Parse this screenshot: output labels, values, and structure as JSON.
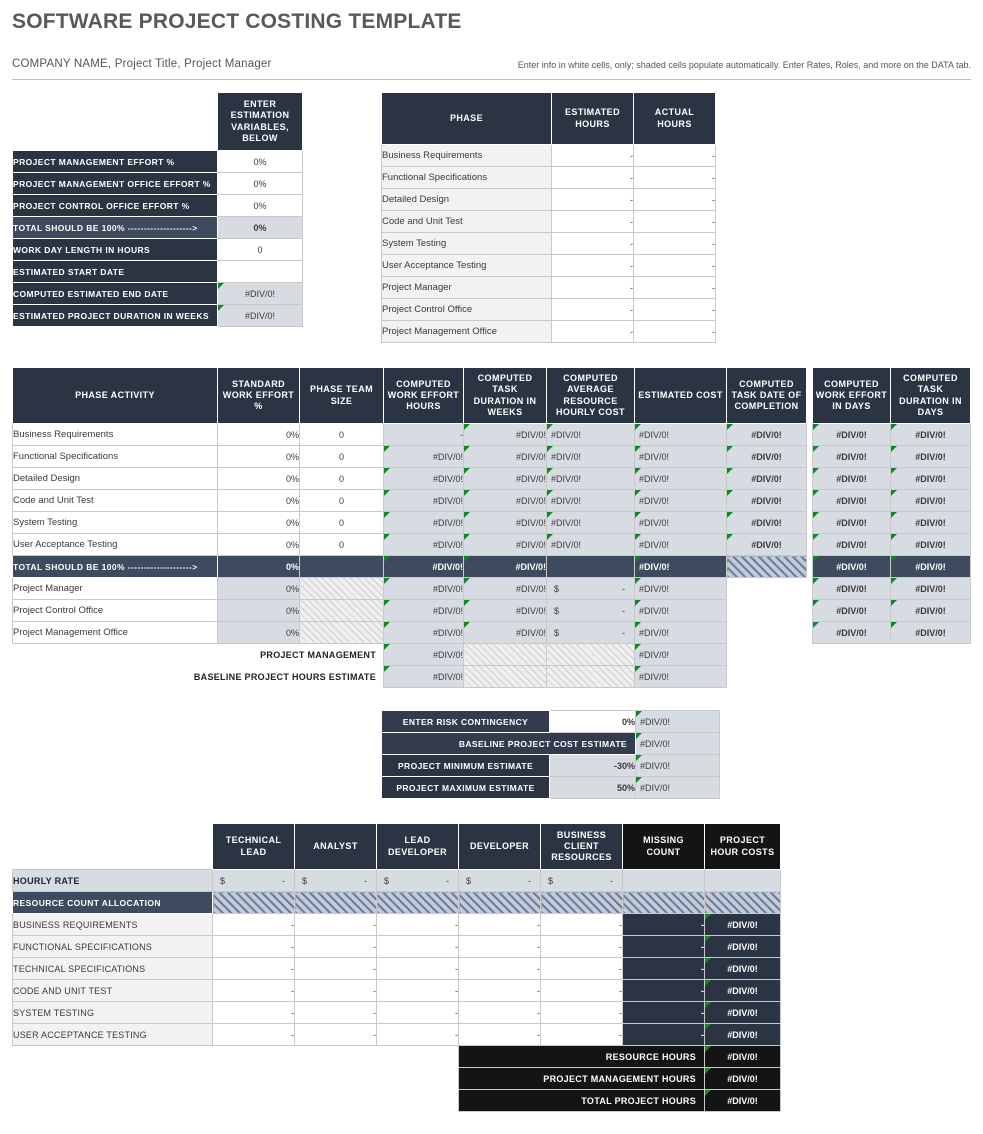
{
  "header": {
    "title": "SOFTWARE PROJECT COSTING TEMPLATE",
    "subtitle_left": "COMPANY NAME, Project Title, Project Manager",
    "subtitle_right": "Enter info in white cells, only; shaded cells populate automatically.  Enter Rates, Roles, and more on the DATA tab."
  },
  "colors": {
    "header_navy": "#2b3443",
    "header_black": "#141414",
    "row_shade": "#d7dce3",
    "total_row": "#3e4a5e",
    "title_grey": "#59595b"
  },
  "estimation": {
    "col_header": "ENTER ESTIMATION VARIABLES, BELOW",
    "rows": [
      {
        "label": "PROJECT MANAGEMENT EFFORT %",
        "value": "0%",
        "kind": "input"
      },
      {
        "label": "PROJECT MANAGEMENT OFFICE EFFORT %",
        "value": "0%",
        "kind": "input"
      },
      {
        "label": "PROJECT CONTROL OFFICE EFFORT %",
        "value": "0%",
        "kind": "input"
      },
      {
        "label": "TOTAL SHOULD BE 100% -------------------->",
        "value": "0%",
        "kind": "total"
      },
      {
        "label": "WORK DAY LENGTH IN HOURS",
        "value": "0",
        "kind": "input"
      },
      {
        "label": "ESTIMATED START DATE",
        "value": "",
        "kind": "input"
      },
      {
        "label": "COMPUTED ESTIMATED END DATE",
        "value": "#DIV/0!",
        "kind": "computed"
      },
      {
        "label": "ESTIMATED PROJECT DURATION IN WEEKS",
        "value": "#DIV/0!",
        "kind": "computed"
      }
    ]
  },
  "phase_table": {
    "columns": [
      "PHASE",
      "ESTIMATED HOURS",
      "ACTUAL HOURS"
    ],
    "rows": [
      {
        "phase": "Business Requirements",
        "estimated": "-",
        "actual": "-"
      },
      {
        "phase": "Functional Specifications",
        "estimated": "-",
        "actual": "-"
      },
      {
        "phase": "Detailed Design",
        "estimated": "-",
        "actual": "-"
      },
      {
        "phase": "Code and Unit Test",
        "estimated": "-",
        "actual": "-"
      },
      {
        "phase": "System Testing",
        "estimated": "-",
        "actual": "-"
      },
      {
        "phase": "User Acceptance Testing",
        "estimated": "-",
        "actual": "-"
      },
      {
        "phase": "Project Manager",
        "estimated": "-",
        "actual": "-"
      },
      {
        "phase": "Project Control Office",
        "estimated": "-",
        "actual": "-"
      },
      {
        "phase": "Project Management Office",
        "estimated": "-",
        "actual": "-"
      }
    ]
  },
  "activity_table": {
    "columns": [
      "PHASE ACTIVITY",
      "STANDARD WORK EFFORT %",
      "PHASE TEAM SIZE",
      "COMPUTED WORK EFFORT HOURS",
      "COMPUTED TASK DURATION IN WEEKS",
      "COMPUTED AVERAGE RESOURCE HOURLY COST",
      "ESTIMATED COST",
      "COMPUTED TASK DATE OF COMPLETION"
    ],
    "rows": [
      {
        "activity": "Business Requirements",
        "effort": "0%",
        "team": "0",
        "hours": "-",
        "weeks": "#DIV/0!",
        "rate": "#DIV/0!",
        "cost": "#DIV/0!",
        "completion": "#DIV/0!"
      },
      {
        "activity": "Functional Specifications",
        "effort": "0%",
        "team": "0",
        "hours": "#DIV/0!",
        "weeks": "#DIV/0!",
        "rate": "#DIV/0!",
        "cost": "#DIV/0!",
        "completion": "#DIV/0!"
      },
      {
        "activity": "Detailed Design",
        "effort": "0%",
        "team": "0",
        "hours": "#DIV/0!",
        "weeks": "#DIV/0!",
        "rate": "#DIV/0!",
        "cost": "#DIV/0!",
        "completion": "#DIV/0!"
      },
      {
        "activity": "Code and Unit Test",
        "effort": "0%",
        "team": "0",
        "hours": "#DIV/0!",
        "weeks": "#DIV/0!",
        "rate": "#DIV/0!",
        "cost": "#DIV/0!",
        "completion": "#DIV/0!"
      },
      {
        "activity": "System Testing",
        "effort": "0%",
        "team": "0",
        "hours": "#DIV/0!",
        "weeks": "#DIV/0!",
        "rate": "#DIV/0!",
        "cost": "#DIV/0!",
        "completion": "#DIV/0!"
      },
      {
        "activity": "User Acceptance Testing",
        "effort": "0%",
        "team": "0",
        "hours": "#DIV/0!",
        "weeks": "#DIV/0!",
        "rate": "#DIV/0!",
        "cost": "#DIV/0!",
        "completion": "#DIV/0!"
      }
    ],
    "total_row": {
      "activity": "TOTAL SHOULD BE 100% -------------------->",
      "effort": "0%",
      "team": "",
      "hours": "#DIV/0!",
      "weeks": "#DIV/0!",
      "rate": "",
      "cost": "#DIV/0!",
      "completion": ""
    },
    "mgmt_rows": [
      {
        "activity": "Project Manager",
        "effort": "0%",
        "team": "",
        "hours": "#DIV/0!",
        "weeks": "#DIV/0!",
        "rate_dollar": "$",
        "rate_value": "-",
        "cost": "#DIV/0!",
        "completion": ""
      },
      {
        "activity": "Project Control Office",
        "effort": "0%",
        "team": "",
        "hours": "#DIV/0!",
        "weeks": "#DIV/0!",
        "rate_dollar": "$",
        "rate_value": "-",
        "cost": "#DIV/0!",
        "completion": ""
      },
      {
        "activity": "Project Management Office",
        "effort": "0%",
        "team": "",
        "hours": "#DIV/0!",
        "weeks": "#DIV/0!",
        "rate_dollar": "$",
        "rate_value": "-",
        "cost": "#DIV/0!",
        "completion": ""
      }
    ],
    "summary_rows": [
      {
        "label": "PROJECT MANAGEMENT",
        "hours": "#DIV/0!",
        "cost": "#DIV/0!"
      },
      {
        "label": "BASELINE PROJECT HOURS ESTIMATE",
        "hours": "#DIV/0!",
        "cost": "#DIV/0!"
      }
    ]
  },
  "days_table": {
    "columns": [
      "COMPUTED WORK EFFORT IN DAYS",
      "COMPUTED TASK DURATION IN DAYS"
    ],
    "rows": [
      {
        "effort_days": "#DIV/0!",
        "duration_days": "#DIV/0!",
        "style": "shade"
      },
      {
        "effort_days": "#DIV/0!",
        "duration_days": "#DIV/0!",
        "style": "shade"
      },
      {
        "effort_days": "#DIV/0!",
        "duration_days": "#DIV/0!",
        "style": "shade"
      },
      {
        "effort_days": "#DIV/0!",
        "duration_days": "#DIV/0!",
        "style": "shade"
      },
      {
        "effort_days": "#DIV/0!",
        "duration_days": "#DIV/0!",
        "style": "shade"
      },
      {
        "effort_days": "#DIV/0!",
        "duration_days": "#DIV/0!",
        "style": "shade"
      },
      {
        "effort_days": "#DIV/0!",
        "duration_days": "#DIV/0!",
        "style": "dark"
      },
      {
        "effort_days": "#DIV/0!",
        "duration_days": "#DIV/0!",
        "style": "shade"
      },
      {
        "effort_days": "#DIV/0!",
        "duration_days": "#DIV/0!",
        "style": "shade"
      },
      {
        "effort_days": "#DIV/0!",
        "duration_days": "#DIV/0!",
        "style": "shade"
      }
    ]
  },
  "risk_table": {
    "rows": [
      {
        "label": "ENTER RISK CONTINGENCY",
        "value": "0%",
        "result": "#DIV/0!",
        "kind": "input",
        "label_style": "alt"
      },
      {
        "label": "BASELINE PROJECT COST ESTIMATE",
        "value": "",
        "result": "#DIV/0!",
        "kind": "computed",
        "label_style": "alt"
      },
      {
        "label": "PROJECT MINIMUM ESTIMATE",
        "value": "-30%",
        "result": "#DIV/0!",
        "kind": "computed",
        "label_style": "dark"
      },
      {
        "label": "PROJECT MAXIMUM ESTIMATE",
        "value": "50%",
        "result": "#DIV/0!",
        "kind": "computed",
        "label_style": "dark"
      }
    ]
  },
  "resource_table": {
    "columns": [
      "TECHNICAL LEAD",
      "ANALYST",
      "LEAD DEVELOPER",
      "DEVELOPER",
      "BUSINESS CLIENT RESOURCES",
      "MISSING COUNT",
      "PROJECT HOUR COSTS"
    ],
    "hourly_rate_label": "HOURLY RATE",
    "hourly_rates": [
      {
        "dollar": "$",
        "value": "-"
      },
      {
        "dollar": "$",
        "value": "-"
      },
      {
        "dollar": "$",
        "value": "-"
      },
      {
        "dollar": "$",
        "value": "-"
      },
      {
        "dollar": "$",
        "value": "-"
      }
    ],
    "allocation_label": "RESOURCE COUNT ALLOCATION",
    "rows": [
      {
        "activity": "BUSINESS REQUIREMENTS",
        "counts": [
          "-",
          "-",
          "-",
          "-",
          "-"
        ],
        "missing": "-",
        "hour_cost": "#DIV/0!"
      },
      {
        "activity": "FUNCTIONAL SPECIFICATIONS",
        "counts": [
          "-",
          "-",
          "-",
          "-",
          "-"
        ],
        "missing": "-",
        "hour_cost": "#DIV/0!"
      },
      {
        "activity": "TECHNICAL SPECIFICATIONS",
        "counts": [
          "-",
          "-",
          "-",
          "-",
          "-"
        ],
        "missing": "-",
        "hour_cost": "#DIV/0!"
      },
      {
        "activity": "CODE AND UNIT TEST",
        "counts": [
          "-",
          "-",
          "-",
          "-",
          "-"
        ],
        "missing": "-",
        "hour_cost": "#DIV/0!"
      },
      {
        "activity": "SYSTEM TESTING",
        "counts": [
          "-",
          "-",
          "-",
          "-",
          "-"
        ],
        "missing": "-",
        "hour_cost": "#DIV/0!"
      },
      {
        "activity": "USER ACCEPTANCE TESTING",
        "counts": [
          "-",
          "-",
          "-",
          "-",
          "-"
        ],
        "missing": "-",
        "hour_cost": "#DIV/0!"
      }
    ],
    "totals": [
      {
        "label": "RESOURCE HOURS",
        "value": "#DIV/0!"
      },
      {
        "label": "PROJECT MANAGEMENT HOURS",
        "value": "#DIV/0!"
      },
      {
        "label": "TOTAL PROJECT HOURS",
        "value": "#DIV/0!"
      }
    ]
  }
}
